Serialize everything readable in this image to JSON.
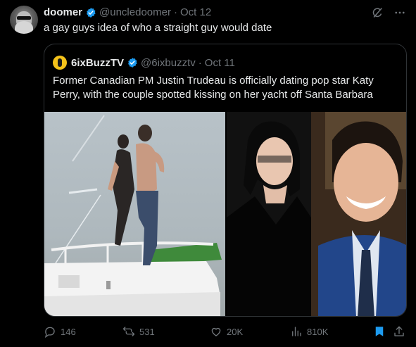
{
  "post": {
    "author_name": "doomer",
    "handle": "@uncledoomer",
    "separator": "·",
    "date": "Oct 12",
    "text": "a gay guys idea of who a straight guy would date"
  },
  "quoted": {
    "author_name": "6ixBuzzTV",
    "handle": "@6ixbuzztv",
    "separator": "·",
    "date": "Oct 11",
    "text": "Former Canadian PM Justin Trudeau is officially dating pop star Katy Perry, with the couple spotted kissing on her yacht off Santa Barbara"
  },
  "stats": {
    "replies": "146",
    "reposts": "531",
    "likes": "20K",
    "views": "810K"
  },
  "colors": {
    "background": "#000000",
    "text": "#e7e9ea",
    "muted": "#71767b",
    "verified": "#1d9bf0",
    "border": "#2f3336"
  },
  "icons": [
    "verified-badge-icon",
    "grok-icon",
    "more-icon",
    "reply-icon",
    "repost-icon",
    "like-icon",
    "views-icon",
    "bookmark-icon",
    "share-icon"
  ]
}
